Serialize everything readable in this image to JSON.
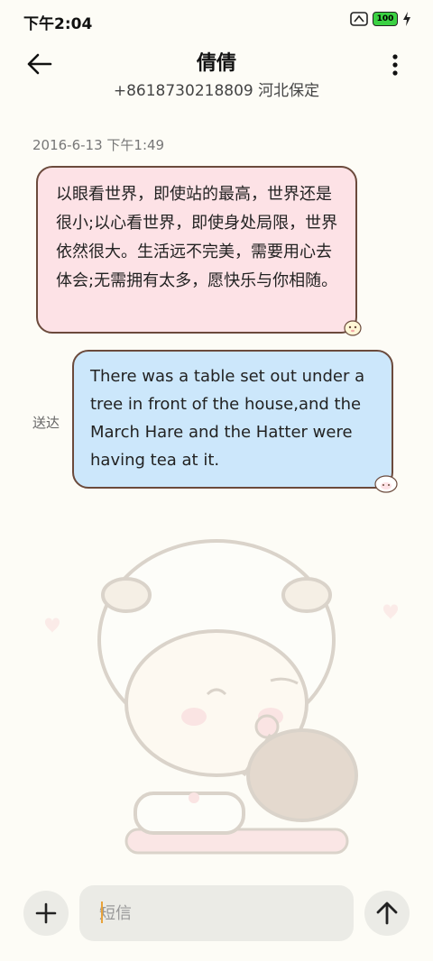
{
  "status_bar": {
    "time": "下午2:04",
    "battery": "100"
  },
  "header": {
    "contact_name": "倩倩",
    "contact_detail": "+8618730218809 河北保定"
  },
  "conversation": {
    "date_label": "2016-6-13 下午1:49",
    "messages": [
      {
        "direction": "incoming",
        "text": "以眼看世界，即使站的最高，世界还是很小;以心看世界，即使身处局限，世界依然很大。生活远不完美，需要用心去体会;无需拥有太多，愿快乐与你相随。"
      },
      {
        "direction": "outgoing",
        "text": "There was a table set out under a tree in front of the house,and the March Hare and the Hatter were having tea at it.",
        "status": "送达"
      }
    ]
  },
  "composer": {
    "placeholder": "短信"
  },
  "colors": {
    "incoming_bubble": "#fde2e6",
    "outgoing_bubble": "#cce7fb",
    "bubble_border": "#6b4a3c",
    "background": "#fdfcf6"
  },
  "icons": {
    "back": "back-arrow-icon",
    "more": "more-vertical-icon",
    "add": "plus-icon",
    "send": "arrow-up-icon"
  }
}
